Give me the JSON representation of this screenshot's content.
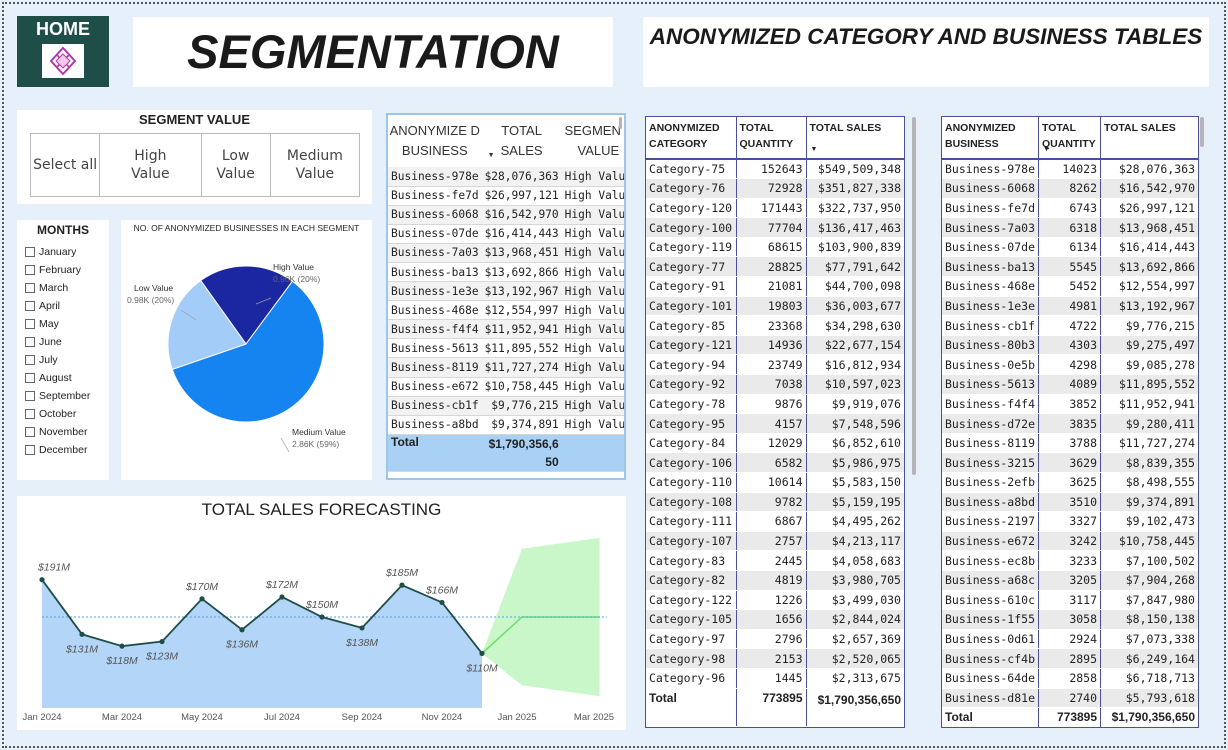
{
  "home": {
    "label": "HOME"
  },
  "title": "SEGMENTATION",
  "title2": "ANONYMIZED CATEGORY AND BUSINESS TABLES",
  "segment_slicer": {
    "title": "SEGMENT VALUE",
    "options": [
      "Select all",
      "High Value",
      "Low Value",
      "Medium Value"
    ]
  },
  "months": {
    "title": "MONTHS",
    "items": [
      "January",
      "February",
      "March",
      "April",
      "May",
      "June",
      "July",
      "August",
      "September",
      "October",
      "November",
      "December"
    ]
  },
  "pie": {
    "title": "NO. OF ANONYMIZED BUSINESSES IN EACH SEGMENT",
    "slices": [
      {
        "name": "High Value",
        "label": "0.96K (20%)",
        "value": 0.96,
        "color": "#1b27a0"
      },
      {
        "name": "Medium Value",
        "label": "2.86K (59%)",
        "value": 2.86,
        "color": "#1584f0"
      },
      {
        "name": "Low Value",
        "label": "0.98K (20%)",
        "value": 0.98,
        "color": "#a3cdf8"
      }
    ]
  },
  "biz_table": {
    "headers": [
      "ANONYMIZE D BUSINESS",
      "TOTAL SALES",
      "SEGMEN T VALUE"
    ],
    "rows": [
      [
        "Business-978e",
        "$28,076,363",
        "High Value"
      ],
      [
        "Business-fe7d",
        "$26,997,121",
        "High Value"
      ],
      [
        "Business-6068",
        "$16,542,970",
        "High Value"
      ],
      [
        "Business-07de",
        "$16,414,443",
        "High Value"
      ],
      [
        "Business-7a03",
        "$13,968,451",
        "High Value"
      ],
      [
        "Business-ba13",
        "$13,692,866",
        "High Value"
      ],
      [
        "Business-1e3e",
        "$13,192,967",
        "High Value"
      ],
      [
        "Business-468e",
        "$12,554,997",
        "High Value"
      ],
      [
        "Business-f4f4",
        "$11,952,941",
        "High Value"
      ],
      [
        "Business-5613",
        "$11,895,552",
        "High Value"
      ],
      [
        "Business-8119",
        "$11,727,274",
        "High Value"
      ],
      [
        "Business-e672",
        "$10,758,445",
        "High Value"
      ],
      [
        "Business-cb1f",
        "$9,776,215",
        "High Value"
      ],
      [
        "Business-a8bd",
        "$9,374,891",
        "High Value"
      ]
    ],
    "total_label": "Total",
    "total_value": "$1,790,356,650"
  },
  "forecast": {
    "title": "TOTAL SALES FORECASTING"
  },
  "chart_data": {
    "type": "area",
    "title": "TOTAL SALES FORECASTING",
    "x_ticks": [
      "Jan 2024",
      "Mar 2024",
      "May 2024",
      "Jul 2024",
      "Sep 2024",
      "Nov 2024",
      "Jan 2025",
      "Mar 2025"
    ],
    "x": [
      "Jan 2024",
      "Feb 2024",
      "Mar 2024",
      "Apr 2024",
      "May 2024",
      "Jun 2024",
      "Jul 2024",
      "Aug 2024",
      "Sep 2024",
      "Oct 2024",
      "Nov 2024",
      "Dec 2024"
    ],
    "series": [
      {
        "values": [
          191,
          131,
          118,
          123,
          170,
          136,
          172,
          150,
          138,
          185,
          166,
          110
        ],
        "labels": [
          "$191M",
          "$131M",
          "$118M",
          "$123M",
          "$170M",
          "$136M",
          "$172M",
          "$150M",
          "$138M",
          "$185M",
          "$166M",
          "$110M"
        ]
      }
    ],
    "average_line": 150,
    "forecast": {
      "x": [
        "Dec 2024",
        "Feb 2025",
        "Apr 2025"
      ],
      "values": [
        110,
        150,
        150
      ],
      "upper": [
        110,
        225,
        237
      ],
      "lower": [
        110,
        75,
        63
      ]
    },
    "ylim": [
      50,
      250
    ],
    "colors": {
      "area": "#b3d6f8",
      "line": "#1f4d47",
      "band": "#c9f7c9",
      "forecast_line": "#6ddc6d"
    }
  },
  "category_table": {
    "headers": [
      "ANONYMIZED CATEGORY",
      "TOTAL QUANTITY",
      "TOTAL SALES"
    ],
    "rows": [
      [
        "Category-75",
        "152643",
        "$549,509,348"
      ],
      [
        "Category-76",
        "72928",
        "$351,827,338"
      ],
      [
        "Category-120",
        "171443",
        "$322,737,950"
      ],
      [
        "Category-100",
        "77704",
        "$136,417,463"
      ],
      [
        "Category-119",
        "68615",
        "$103,900,839"
      ],
      [
        "Category-77",
        "28825",
        "$77,791,642"
      ],
      [
        "Category-91",
        "21081",
        "$44,700,098"
      ],
      [
        "Category-101",
        "19803",
        "$36,003,677"
      ],
      [
        "Category-85",
        "23368",
        "$34,298,630"
      ],
      [
        "Category-121",
        "14936",
        "$22,677,154"
      ],
      [
        "Category-94",
        "23749",
        "$16,812,934"
      ],
      [
        "Category-92",
        "7038",
        "$10,597,023"
      ],
      [
        "Category-78",
        "9876",
        "$9,919,076"
      ],
      [
        "Category-95",
        "4157",
        "$7,548,596"
      ],
      [
        "Category-84",
        "12029",
        "$6,852,610"
      ],
      [
        "Category-106",
        "6582",
        "$5,986,975"
      ],
      [
        "Category-110",
        "10614",
        "$5,583,150"
      ],
      [
        "Category-108",
        "9782",
        "$5,159,195"
      ],
      [
        "Category-111",
        "6867",
        "$4,495,262"
      ],
      [
        "Category-107",
        "2757",
        "$4,213,117"
      ],
      [
        "Category-83",
        "2445",
        "$4,058,683"
      ],
      [
        "Category-82",
        "4819",
        "$3,980,705"
      ],
      [
        "Category-122",
        "1226",
        "$3,499,030"
      ],
      [
        "Category-105",
        "1656",
        "$2,844,024"
      ],
      [
        "Category-97",
        "2796",
        "$2,657,369"
      ],
      [
        "Category-98",
        "2153",
        "$2,520,065"
      ],
      [
        "Category-96",
        "1445",
        "$2,313,675"
      ]
    ],
    "total_label": "Total",
    "total_qty": "773895",
    "total_sales": "$1,790,356,650"
  },
  "business_table": {
    "headers": [
      "ANONYMIZED BUSINESS",
      "TOTAL QUANTITY",
      "TOTAL SALES"
    ],
    "rows": [
      [
        "Business-978e",
        "14023",
        "$28,076,363"
      ],
      [
        "Business-6068",
        "8262",
        "$16,542,970"
      ],
      [
        "Business-fe7d",
        "6743",
        "$26,997,121"
      ],
      [
        "Business-7a03",
        "6318",
        "$13,968,451"
      ],
      [
        "Business-07de",
        "6134",
        "$16,414,443"
      ],
      [
        "Business-ba13",
        "5545",
        "$13,692,866"
      ],
      [
        "Business-468e",
        "5452",
        "$12,554,997"
      ],
      [
        "Business-1e3e",
        "4981",
        "$13,192,967"
      ],
      [
        "Business-cb1f",
        "4722",
        "$9,776,215"
      ],
      [
        "Business-80b3",
        "4303",
        "$9,275,497"
      ],
      [
        "Business-0e5b",
        "4298",
        "$9,085,278"
      ],
      [
        "Business-5613",
        "4089",
        "$11,895,552"
      ],
      [
        "Business-f4f4",
        "3852",
        "$11,952,941"
      ],
      [
        "Business-d72e",
        "3835",
        "$9,280,411"
      ],
      [
        "Business-8119",
        "3788",
        "$11,727,274"
      ],
      [
        "Business-3215",
        "3629",
        "$8,839,355"
      ],
      [
        "Business-2efb",
        "3625",
        "$8,498,555"
      ],
      [
        "Business-a8bd",
        "3510",
        "$9,374,891"
      ],
      [
        "Business-2197",
        "3327",
        "$9,102,473"
      ],
      [
        "Business-e672",
        "3242",
        "$10,758,445"
      ],
      [
        "Business-ec8b",
        "3233",
        "$7,100,502"
      ],
      [
        "Business-a68c",
        "3205",
        "$7,904,268"
      ],
      [
        "Business-610c",
        "3117",
        "$7,847,980"
      ],
      [
        "Business-1f55",
        "3058",
        "$8,150,138"
      ],
      [
        "Business-0d61",
        "2924",
        "$7,073,338"
      ],
      [
        "Business-cf4b",
        "2895",
        "$6,249,164"
      ],
      [
        "Business-64de",
        "2858",
        "$6,718,713"
      ],
      [
        "Business-d81e",
        "2740",
        "$5,793,618"
      ]
    ],
    "total_label": "Total",
    "total_qty": "773895",
    "total_sales": "$1,790,356,650"
  }
}
